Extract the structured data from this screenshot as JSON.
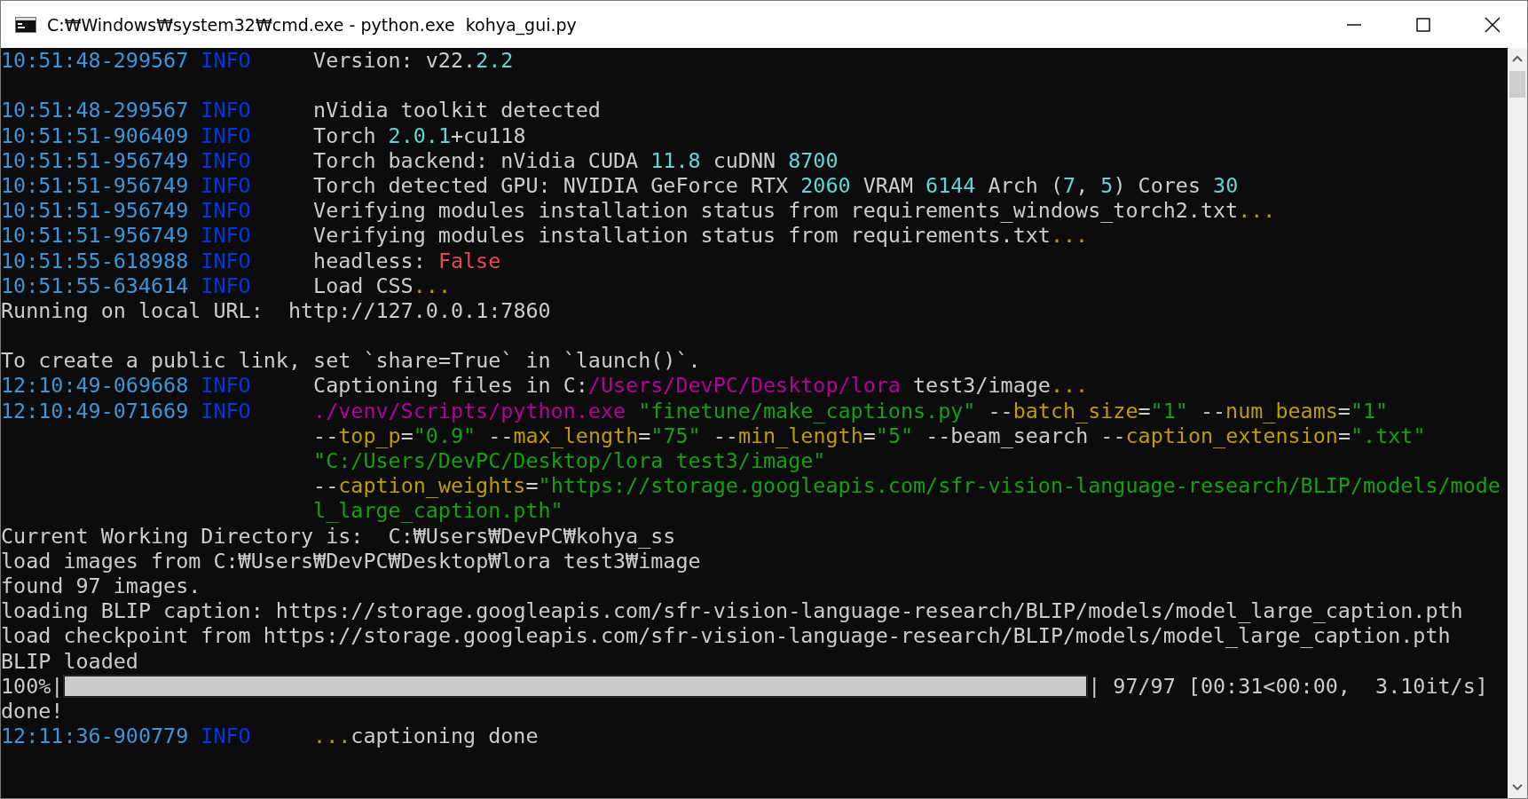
{
  "window": {
    "title": "C:₩Windows₩system32₩cmd.exe - python.exe  kohya_gui.py"
  },
  "lines": [
    {
      "kind": "log",
      "timestamp": "10:51:48-299567",
      "severity": "INFO",
      "message": [
        {
          "kind": "text",
          "text": "Version: v22."
        },
        {
          "kind": "number",
          "text": "2.2"
        }
      ]
    },
    {
      "kind": "blank"
    },
    {
      "kind": "log",
      "timestamp": "10:51:48-299567",
      "severity": "INFO",
      "message": [
        {
          "kind": "text",
          "text": "nVidia toolkit detected"
        }
      ]
    },
    {
      "kind": "log",
      "timestamp": "10:51:51-906409",
      "severity": "INFO",
      "message": [
        {
          "kind": "text",
          "text": "Torch "
        },
        {
          "kind": "number",
          "text": "2.0.1"
        },
        {
          "kind": "text",
          "text": "+cu118"
        }
      ]
    },
    {
      "kind": "log",
      "timestamp": "10:51:51-956749",
      "severity": "INFO",
      "message": [
        {
          "kind": "text",
          "text": "Torch backend: nVidia CUDA "
        },
        {
          "kind": "number",
          "text": "11.8"
        },
        {
          "kind": "text",
          "text": " cuDNN "
        },
        {
          "kind": "number",
          "text": "8700"
        }
      ]
    },
    {
      "kind": "log",
      "timestamp": "10:51:51-956749",
      "severity": "INFO",
      "message": [
        {
          "kind": "text",
          "text": "Torch detected GPU: NVIDIA GeForce RTX "
        },
        {
          "kind": "number",
          "text": "2060"
        },
        {
          "kind": "text",
          "text": " VRAM "
        },
        {
          "kind": "number",
          "text": "6144"
        },
        {
          "kind": "text",
          "text": " Arch ("
        },
        {
          "kind": "number",
          "text": "7"
        },
        {
          "kind": "text",
          "text": ", "
        },
        {
          "kind": "number",
          "text": "5"
        },
        {
          "kind": "text",
          "text": ") Cores "
        },
        {
          "kind": "number",
          "text": "30"
        }
      ]
    },
    {
      "kind": "log",
      "timestamp": "10:51:51-956749",
      "severity": "INFO",
      "message": [
        {
          "kind": "text",
          "text": "Verifying modules installation status from requirements_windows_torch2.txt"
        },
        {
          "kind": "dots",
          "text": "..."
        }
      ]
    },
    {
      "kind": "log",
      "timestamp": "10:51:51-956749",
      "severity": "INFO",
      "message": [
        {
          "kind": "text",
          "text": "Verifying modules installation status from requirements.txt"
        },
        {
          "kind": "dots",
          "text": "..."
        }
      ]
    },
    {
      "kind": "log",
      "timestamp": "10:51:55-618988",
      "severity": "INFO",
      "message": [
        {
          "kind": "text",
          "text": "headless: "
        },
        {
          "kind": "false",
          "text": "False"
        }
      ]
    },
    {
      "kind": "log",
      "timestamp": "10:51:55-634614",
      "severity": "INFO",
      "message": [
        {
          "kind": "text",
          "text": "Load CSS"
        },
        {
          "kind": "dots",
          "text": "..."
        }
      ]
    },
    {
      "kind": "plain",
      "message": [
        {
          "kind": "text",
          "text": "Running on local URL:  http://127.0.0.1:7860"
        }
      ]
    },
    {
      "kind": "blank"
    },
    {
      "kind": "plain",
      "message": [
        {
          "kind": "text",
          "text": "To create a public link, set `share=True` in `launch()`."
        }
      ]
    },
    {
      "kind": "log",
      "timestamp": "12:10:49-069668",
      "severity": "INFO",
      "message": [
        {
          "kind": "text",
          "text": "Captioning files in C:"
        },
        {
          "kind": "path",
          "text": "/Users/DevPC/Desktop/lora"
        },
        {
          "kind": "text",
          "text": " test3/image"
        },
        {
          "kind": "dots",
          "text": "..."
        }
      ]
    },
    {
      "kind": "log",
      "timestamp": "12:10:49-071669",
      "severity": "INFO",
      "message": [
        {
          "kind": "path",
          "text": "./venv/Scripts/python.exe"
        },
        {
          "kind": "string",
          "text": " \"finetune/make_captions.py\""
        },
        {
          "kind": "text",
          "text": " --"
        },
        {
          "kind": "option",
          "text": "batch_size"
        },
        {
          "kind": "text",
          "text": "="
        },
        {
          "kind": "string",
          "text": "\"1\""
        },
        {
          "kind": "text",
          "text": " --"
        },
        {
          "kind": "option",
          "text": "num_beams"
        },
        {
          "kind": "text",
          "text": "="
        },
        {
          "kind": "string",
          "text": "\"1\""
        }
      ]
    },
    {
      "kind": "continuation",
      "message": [
        {
          "kind": "text",
          "text": "--"
        },
        {
          "kind": "option",
          "text": "top_p"
        },
        {
          "kind": "text",
          "text": "="
        },
        {
          "kind": "string",
          "text": "\"0.9\""
        },
        {
          "kind": "text",
          "text": " --"
        },
        {
          "kind": "option",
          "text": "max_length"
        },
        {
          "kind": "text",
          "text": "="
        },
        {
          "kind": "string",
          "text": "\"75\""
        },
        {
          "kind": "text",
          "text": " --"
        },
        {
          "kind": "option",
          "text": "min_length"
        },
        {
          "kind": "text",
          "text": "="
        },
        {
          "kind": "string",
          "text": "\"5\""
        },
        {
          "kind": "text",
          "text": " --beam_search --"
        },
        {
          "kind": "option",
          "text": "caption_extension"
        },
        {
          "kind": "text",
          "text": "="
        },
        {
          "kind": "string",
          "text": "\".txt\""
        }
      ]
    },
    {
      "kind": "continuation",
      "message": [
        {
          "kind": "string",
          "text": "\"C:/Users/DevPC/Desktop/lora test3/image\""
        }
      ]
    },
    {
      "kind": "continuation",
      "message": [
        {
          "kind": "text",
          "text": "--"
        },
        {
          "kind": "option",
          "text": "caption_weights"
        },
        {
          "kind": "text",
          "text": "="
        },
        {
          "kind": "string",
          "text": "\"https://storage.googleapis.com/sfr-vision-language-research/BLIP/models/mode"
        }
      ]
    },
    {
      "kind": "continuation",
      "message": [
        {
          "kind": "string",
          "text": "l_large_caption.pth\""
        }
      ]
    },
    {
      "kind": "plain",
      "message": [
        {
          "kind": "text",
          "text": "Current Working Directory is:  C:₩Users₩DevPC₩kohya_ss"
        }
      ]
    },
    {
      "kind": "plain",
      "message": [
        {
          "kind": "text",
          "text": "load images from C:₩Users₩DevPC₩Desktop₩lora test3₩image"
        }
      ]
    },
    {
      "kind": "plain",
      "message": [
        {
          "kind": "text",
          "text": "found 97 images."
        }
      ]
    },
    {
      "kind": "plain",
      "message": [
        {
          "kind": "text",
          "text": "loading BLIP caption: https://storage.googleapis.com/sfr-vision-language-research/BLIP/models/model_large_caption.pth"
        }
      ]
    },
    {
      "kind": "plain",
      "message": [
        {
          "kind": "text",
          "text": "load checkpoint from https://storage.googleapis.com/sfr-vision-language-research/BLIP/models/model_large_caption.pth"
        }
      ]
    },
    {
      "kind": "plain",
      "message": [
        {
          "kind": "text",
          "text": "BLIP loaded"
        }
      ]
    },
    {
      "kind": "progress",
      "prefix": "100%|",
      "level": 1,
      "suffix": "| 97/97 [00:31<00:00,  3.10it/s]"
    },
    {
      "kind": "plain",
      "message": [
        {
          "kind": "text",
          "text": "done!"
        }
      ]
    },
    {
      "kind": "log",
      "timestamp": "12:11:36-900779",
      "severity": "INFO",
      "message": [
        {
          "kind": "dots",
          "text": "..."
        },
        {
          "kind": "text",
          "text": "captioning done"
        }
      ]
    }
  ]
}
